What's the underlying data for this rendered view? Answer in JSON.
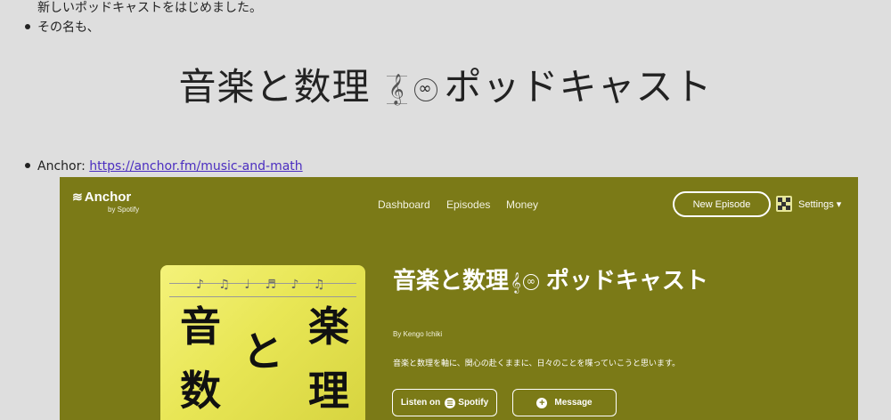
{
  "article": {
    "line1": "新しいポッドキャストをはじめました。",
    "bullet1": "その名も、",
    "headline": {
      "prefix": "音楽と数理",
      "clef": "𝄞",
      "infinity": "∞",
      "suffix": "ポッドキャスト"
    },
    "bullet2_label": "Anchor: ",
    "bullet2_link": "https://anchor.fm/music-and-math"
  },
  "anchor_app": {
    "logo": "Anchor",
    "logo_sub": "by Spotify",
    "nav": [
      "Dashboard",
      "Episodes",
      "Money"
    ],
    "new_episode_button": "New Episode",
    "settings_label": "Settings ▾",
    "cover_kanji": [
      "音",
      "楽",
      "と",
      "数",
      "理"
    ],
    "cover_notes": "♪ ♫ ♩ ♬ ♪ ♫",
    "show_title_prefix": "音楽と数理",
    "show_title_clef": "𝄞",
    "show_title_infinity": "∞",
    "show_title_suffix": "ポッドキャスト",
    "byline": "By Kengo Ichiki",
    "description": "音楽と数理を軸に、関心の赴くままに、日々のことを喋っていこうと思います。",
    "listen_on_label": "Listen on",
    "spotify_label": "Spotify",
    "message_button": "Message",
    "colors": {
      "background": "#7b7a17",
      "cover": "#e8e655"
    }
  }
}
